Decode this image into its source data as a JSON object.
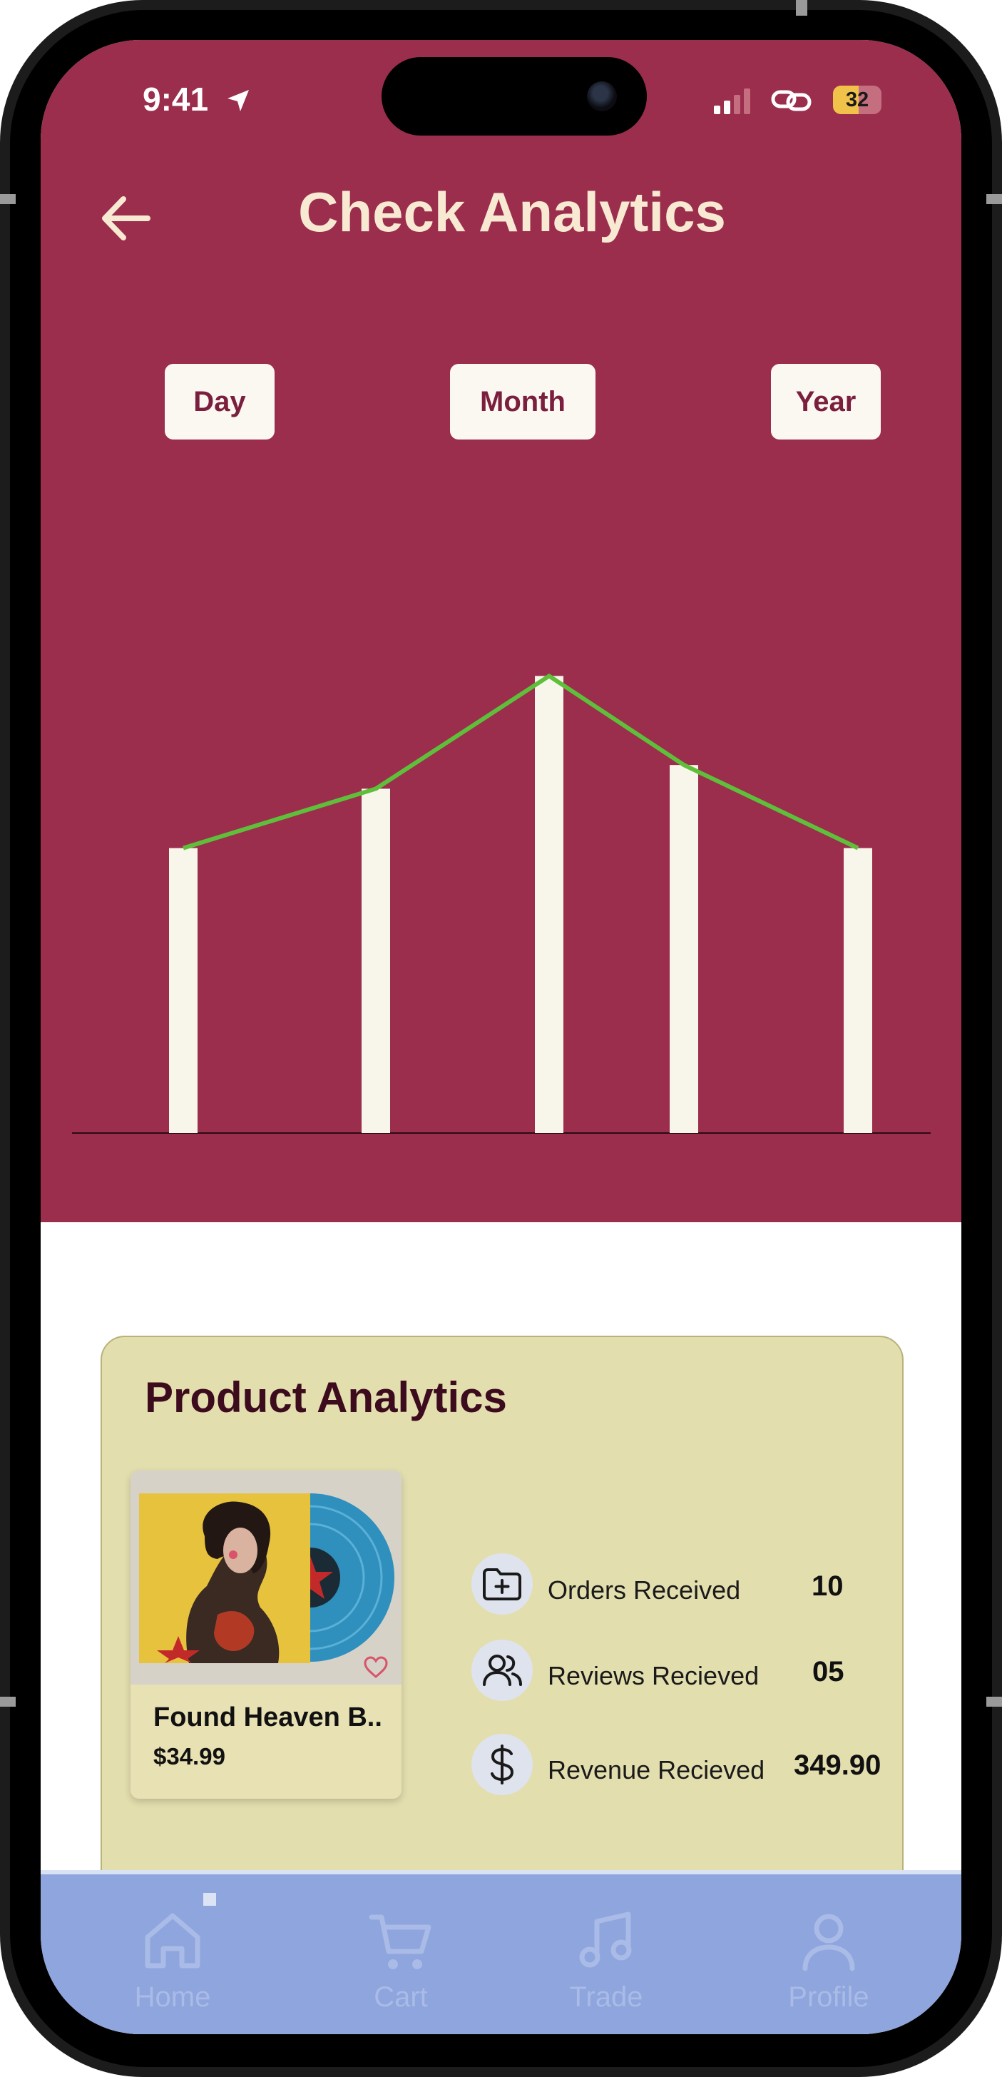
{
  "status_bar": {
    "time": "9:41",
    "battery": "32"
  },
  "header": {
    "title": "Check Analytics"
  },
  "range_tabs": [
    "Day",
    "Month",
    "Year"
  ],
  "chart_data": {
    "type": "bar",
    "categories": [
      "",
      "",
      "",
      "",
      ""
    ],
    "values": [
      48,
      58,
      77,
      62,
      48
    ],
    "trend_line": [
      48,
      58,
      77,
      62,
      48
    ],
    "ylim": [
      0,
      100
    ],
    "bar_color": "#f8f6ea",
    "line_color": "#5fbf3a"
  },
  "product_analytics": {
    "title": "Product Analytics",
    "product": {
      "name": "Found Heaven B..",
      "price": "$34.99"
    },
    "stats": [
      {
        "icon": "folder-plus-icon",
        "label": "Orders Received",
        "value": "10"
      },
      {
        "icon": "users-icon",
        "label": "Reviews Recieved",
        "value": "05"
      },
      {
        "icon": "dollar-icon",
        "label": "Revenue Recieved",
        "value": "349.90"
      }
    ]
  },
  "tabbar": {
    "items": [
      {
        "icon": "home-icon",
        "label": "Home"
      },
      {
        "icon": "cart-icon",
        "label": "Cart"
      },
      {
        "icon": "music-icon",
        "label": "Trade"
      },
      {
        "icon": "profile-icon",
        "label": "Profile"
      }
    ]
  },
  "colors": {
    "primary": "#9b2d4d",
    "title_text": "#f8e9d2",
    "card_bg": "#e3deae",
    "tabbar_bg": "#8ea5dd"
  }
}
